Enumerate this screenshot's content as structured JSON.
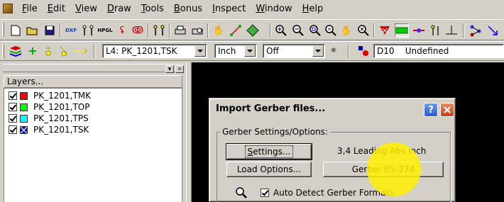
{
  "menubar": {
    "items": [
      {
        "label": "File",
        "key": "F",
        "rest": "ile"
      },
      {
        "label": "Edit",
        "key": "E",
        "rest": "dit"
      },
      {
        "label": "View",
        "key": "V",
        "rest": "iew"
      },
      {
        "label": "Draw",
        "key": "D",
        "rest": "raw"
      },
      {
        "label": "Tools",
        "key": "T",
        "rest": "ools"
      },
      {
        "label": "Bonus",
        "key": "B",
        "rest": "onus"
      },
      {
        "label": "Inspect",
        "key": "I",
        "rest": "nspect"
      },
      {
        "label": "Window",
        "key": "W",
        "rest": "indow"
      },
      {
        "label": "Help",
        "key": "H",
        "rest": "elp"
      }
    ]
  },
  "toolbar2": {
    "layer_combo": "L4: PK_1201,TSK",
    "units_combo": "Inch",
    "snap_combo": "Off",
    "dcode_combo": "D10    Undefined"
  },
  "layers_panel": {
    "header": "Layers...",
    "layers": [
      {
        "name": "PK_1201,TMK",
        "color": "#ff0000",
        "checked": true
      },
      {
        "name": "PK_1201,TOP",
        "color": "#00ff00",
        "checked": true
      },
      {
        "name": "PK_1201,TPS",
        "color": "#00ffff",
        "checked": true
      },
      {
        "name": "PK_1201,TSK",
        "color": "#0000ff",
        "checked": true
      }
    ]
  },
  "dialog": {
    "title": "Import Gerber files...",
    "help_label": "?",
    "close_label": "X",
    "group_label": "Gerber Settings/Options:",
    "settings_key": "S",
    "settings_rest": "ettings...",
    "load_options_label": "Load Options...",
    "format_text": "3,4 Leading Abs Inch",
    "gerber_format_label": "Gerber RS-274",
    "auto_detect_label": "Auto Detect Gerber Formats",
    "auto_detect_checked": true
  },
  "colors": {
    "window_bg": "#d4d0c8",
    "canvas_bg": "#000000",
    "highlight": "#fff000"
  }
}
